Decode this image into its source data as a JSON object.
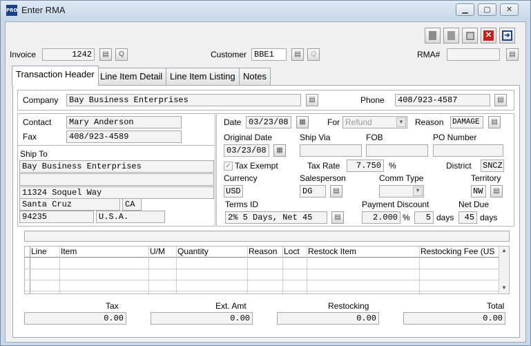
{
  "window": {
    "title": "Enter RMA",
    "app_icon": "PRO"
  },
  "toolbar": {
    "icons": [
      "first-record-icon",
      "next-record-icon",
      "save-icon",
      "delete-icon",
      "exit-icon"
    ]
  },
  "header": {
    "invoice_label": "Invoice",
    "invoice_value": "1242",
    "customer_label": "Customer",
    "customer_value": "BBE1",
    "rma_label": "RMA#",
    "rma_value": ""
  },
  "tabs": [
    "Transaction Header",
    "Line Item Detail",
    "Line Item Listing",
    "Notes"
  ],
  "company": {
    "company_label": "Company",
    "company_value": "Bay Business Enterprises",
    "phone_label": "Phone",
    "phone_value": "408/923-4587"
  },
  "contact": {
    "contact_label": "Contact",
    "contact_value": "Mary Anderson",
    "fax_label": "Fax",
    "fax_value": "408/923-4589"
  },
  "ship_to": {
    "label": "Ship To",
    "line1": "Bay Business Enterprises",
    "line2": "",
    "line3": "11324 Soquel Way",
    "city": "Santa Cruz",
    "state": "CA",
    "zip": "94235",
    "country": "U.S.A."
  },
  "details": {
    "date_label": "Date",
    "date_value": "03/23/08",
    "for_label": "For",
    "for_value": "Refund",
    "reason_label": "Reason",
    "reason_value": "DAMAGE",
    "original_date_label": "Original Date",
    "original_date_value": "03/23/08",
    "ship_via_label": "Ship Via",
    "ship_via_value": "",
    "fob_label": "FOB",
    "fob_value": "",
    "po_number_label": "PO Number",
    "po_number_value": "",
    "tax_exempt_label": "Tax Exempt",
    "tax_exempt_checked": true,
    "tax_rate_label": "Tax Rate",
    "tax_rate_value": "7.750",
    "tax_rate_unit": "%",
    "district_label": "District",
    "district_value": "SNCZ",
    "currency_label": "Currency",
    "currency_value": "USD",
    "salesperson_label": "Salesperson",
    "salesperson_value": "DG",
    "comm_type_label": "Comm Type",
    "comm_type_value": "",
    "territory_label": "Territory",
    "territory_value": "NW",
    "terms_label": "Terms ID",
    "terms_value": "2% 5 Days, Net 45",
    "payment_discount_label": "Payment Discount",
    "payment_discount_value": "2.000",
    "payment_discount_unit": "%",
    "payment_discount_days": "5",
    "days_label": "days",
    "net_due_label": "Net Due",
    "net_due_value": "45",
    "net_due_days_label": "days"
  },
  "grid": {
    "columns": [
      "Line",
      "Item",
      "U/M",
      "Quantity",
      "Reason",
      "Loct",
      "Restock Item",
      "Restocking Fee (US"
    ]
  },
  "totals": {
    "tax_label": "Tax",
    "tax_value": "0.00",
    "ext_amt_label": "Ext. Amt",
    "ext_amt_value": "0.00",
    "restocking_label": "Restocking",
    "restocking_value": "0.00",
    "total_label": "Total",
    "total_value": "0.00"
  }
}
